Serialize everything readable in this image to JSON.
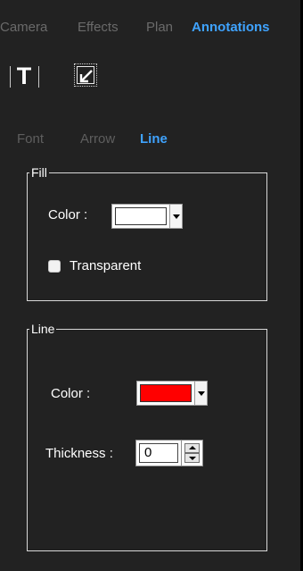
{
  "main_tabs": [
    {
      "label": "Camera",
      "active": false
    },
    {
      "label": "Effects",
      "active": false
    },
    {
      "label": "Plan",
      "active": false
    },
    {
      "label": "Annotations",
      "active": true
    }
  ],
  "tools": {
    "text_tool_glyph": "T",
    "text_tool_icon": "text-tool-icon",
    "arrow_tool_icon": "arrow-tool-icon"
  },
  "sub_tabs": [
    {
      "label": "Font",
      "active": false
    },
    {
      "label": "Arrow",
      "active": false
    },
    {
      "label": "Line",
      "active": true
    }
  ],
  "fill": {
    "title": "Fill",
    "color_label": "Color :",
    "color_value": "#ffffff",
    "transparent_label": "Transparent",
    "transparent_checked": false
  },
  "line": {
    "title": "Line",
    "color_label": "Color :",
    "color_value": "#ff0000",
    "thickness_label": "Thickness :",
    "thickness_value": "0"
  },
  "colors": {
    "accent": "#3fa3ff",
    "panel_bg": "#222222",
    "inactive_tab": "#6a6a6a"
  }
}
